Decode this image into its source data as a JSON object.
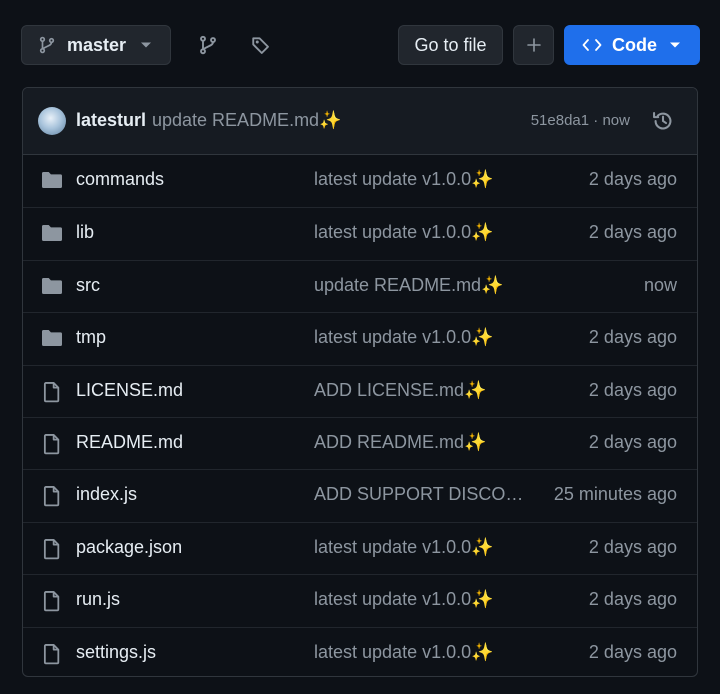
{
  "branch": {
    "name": "master"
  },
  "toolbar": {
    "goto_label": "Go to file",
    "add_label": "+",
    "code_label": "Code"
  },
  "commit": {
    "author": "latesturl",
    "message": "update README.md✨",
    "sha": "51e8da1",
    "sep": "·",
    "time": "now"
  },
  "files": [
    {
      "type": "dir",
      "name": "commands",
      "message": "latest update v1.0.0✨",
      "age": "2 days ago"
    },
    {
      "type": "dir",
      "name": "lib",
      "message": "latest update v1.0.0✨",
      "age": "2 days ago"
    },
    {
      "type": "dir",
      "name": "src",
      "message": "update README.md✨",
      "age": "now"
    },
    {
      "type": "dir",
      "name": "tmp",
      "message": "latest update v1.0.0✨",
      "age": "2 days ago"
    },
    {
      "type": "file",
      "name": "LICENSE.md",
      "message": "ADD LICENSE.md✨",
      "age": "2 days ago"
    },
    {
      "type": "file",
      "name": "README.md",
      "message": "ADD README.md✨",
      "age": "2 days ago"
    },
    {
      "type": "file",
      "name": "index.js",
      "message": "ADD SUPPORT DISCORD…",
      "age": "25 minutes ago"
    },
    {
      "type": "file",
      "name": "package.json",
      "message": "latest update v1.0.0✨",
      "age": "2 days ago"
    },
    {
      "type": "file",
      "name": "run.js",
      "message": "latest update v1.0.0✨",
      "age": "2 days ago"
    },
    {
      "type": "file",
      "name": "settings.js",
      "message": "latest update v1.0.0✨",
      "age": "2 days ago"
    }
  ],
  "colors": {
    "background": "#0d1117",
    "accent": "#1f6feb",
    "muted": "#8d96a0",
    "border": "#30363d"
  },
  "icons": {
    "branch": "git-branch-icon",
    "tag": "tag-icon",
    "history": "history-icon",
    "folder": "folder-icon",
    "file": "file-icon"
  }
}
